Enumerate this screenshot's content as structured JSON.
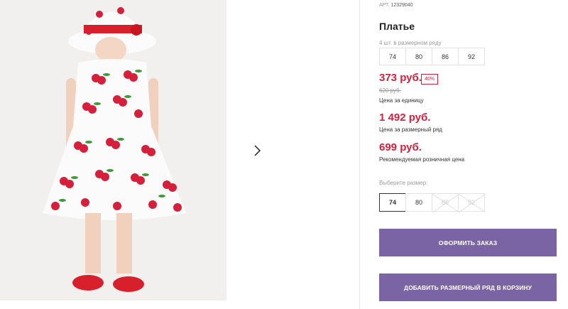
{
  "product": {
    "article_label": "АРТ.",
    "article_number": "12329040",
    "title": "Платье",
    "sizes_note": "4 шт. в размерном ряду",
    "size_range": [
      "74",
      "80",
      "86",
      "92"
    ]
  },
  "pricing": {
    "unit_price": "373 руб.",
    "discount": "40%",
    "old_price": "620 руб.",
    "unit_price_label": "Цена за единицу",
    "range_price": "1 492 руб.",
    "range_price_label": "Цена за размерный ряд",
    "retail_price": "699 руб.",
    "retail_price_label": "Рекомендуемая розничная цена"
  },
  "size_picker": {
    "label": "Выберите размер:",
    "options": [
      {
        "value": "74",
        "state": "selected"
      },
      {
        "value": "80",
        "state": "available"
      },
      {
        "value": "86",
        "state": "unavailable"
      },
      {
        "value": "92",
        "state": "unavailable"
      }
    ]
  },
  "actions": {
    "checkout_label": "ОФОРМИТЬ ЗАКАЗ",
    "add_range_label": "ДОБАВИТЬ РАЗМЕРНЫЙ РЯД В КОРЗИНУ"
  },
  "icons": {
    "next": "chevron-right-icon"
  },
  "colors": {
    "accent_button": "#7b64a4",
    "price_red": "#d51f3b",
    "muted_text": "#9a9a9a"
  }
}
